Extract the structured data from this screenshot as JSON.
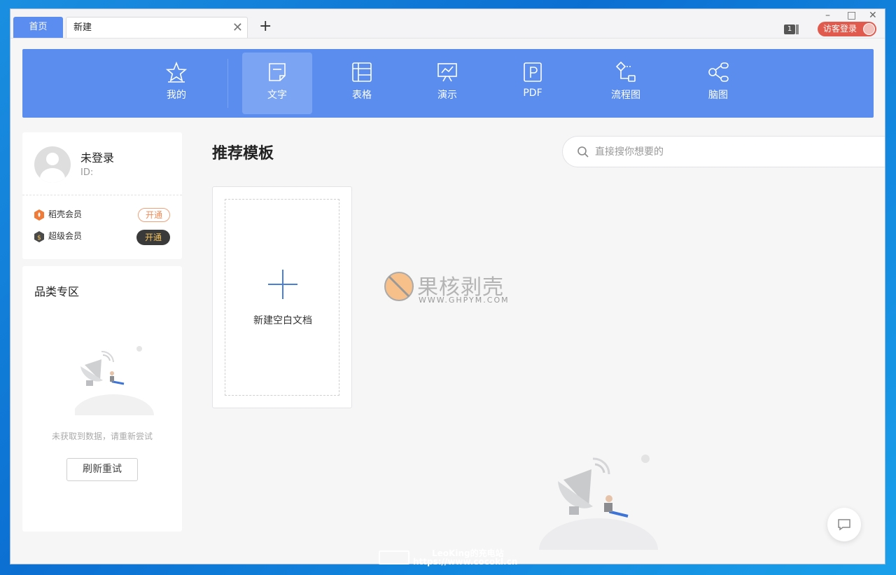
{
  "tabs": {
    "home": "首页",
    "current": "新建",
    "add": "+",
    "close": "✕"
  },
  "window_controls": {
    "minimize": "–",
    "maximize": "□",
    "close": "✕"
  },
  "header": {
    "doc_count": "1",
    "guest_login": "访客登录"
  },
  "categories": [
    {
      "label": "我的",
      "icon": "star-icon"
    },
    {
      "label": "文字",
      "icon": "document-icon",
      "active": true
    },
    {
      "label": "表格",
      "icon": "table-icon"
    },
    {
      "label": "演示",
      "icon": "presentation-icon"
    },
    {
      "label": "PDF",
      "icon": "pdf-icon"
    },
    {
      "label": "流程图",
      "icon": "flowchart-icon"
    },
    {
      "label": "脑图",
      "icon": "mindmap-icon"
    }
  ],
  "profile": {
    "name": "未登录",
    "id_label": "ID:"
  },
  "membership": [
    {
      "name": "稻壳会员",
      "action": "开通"
    },
    {
      "name": "超级会员",
      "action": "开通"
    }
  ],
  "category_zone": {
    "title": "品类专区",
    "empty_text": "未获取到数据，请重新尝试",
    "refresh_label": "刷新重试"
  },
  "main": {
    "title": "推荐模板",
    "search_placeholder": "直接搜你想要的",
    "new_blank_label": "新建空白文档"
  },
  "watermark": {
    "cn": "果核剥壳",
    "en": "WWW.GHPYM.COM"
  },
  "overlay": {
    "line1": "LeoKing的充电站",
    "line2": "https://www.cocokl.cn"
  },
  "colors": {
    "accent": "#5a8ded",
    "active_tab": "#7ba4f2",
    "guest_login": "#e05b4d",
    "desktop": "#0b6fd2"
  }
}
